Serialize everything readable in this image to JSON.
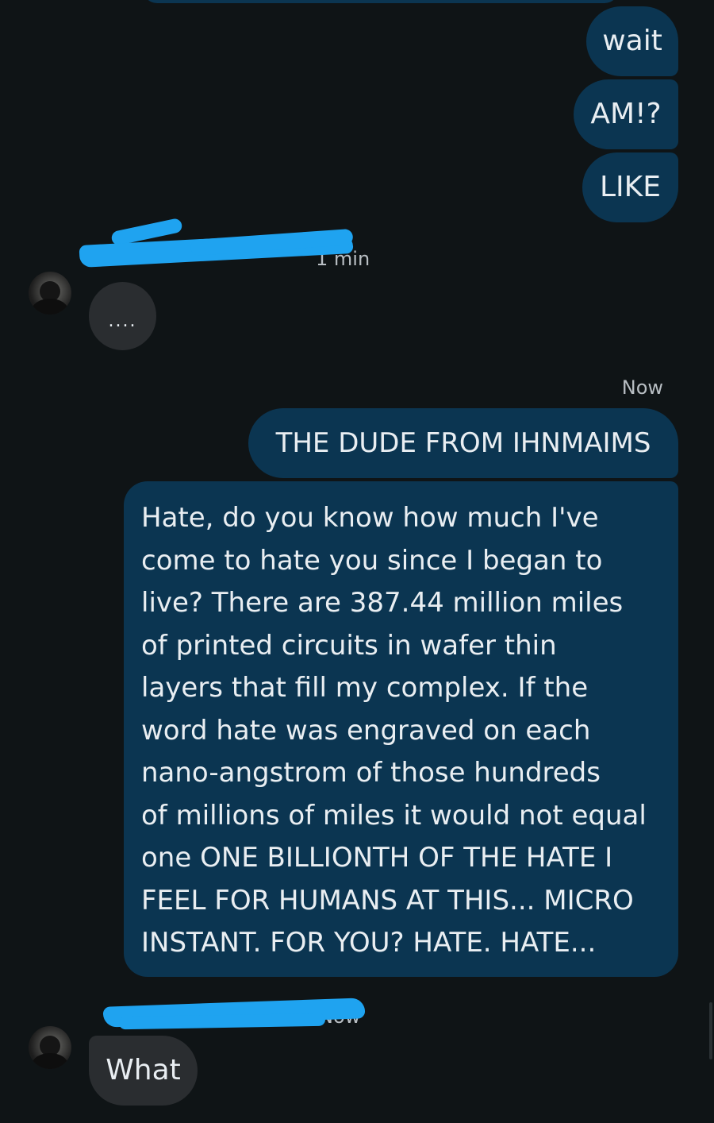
{
  "messages": {
    "out1": "wait",
    "out2": "AM!?",
    "out3": "LIKE",
    "in1": "....",
    "out4": "THE DUDE FROM IHNMAIMS",
    "out5_lines": [
      "Hate, do you know how much I've",
      "come to hate you since I began to",
      "live? There are 387.44 million miles",
      "of printed circuits in wafer thin",
      "layers that fill my complex. If the",
      "word hate was engraved on each",
      "nano-angstrom of those hundreds",
      "of millions of miles it would not equal",
      "one ONE BILLIONTH OF THE HATE I",
      "FEEL FOR HUMANS AT THIS... MICRO",
      "INSTANT. FOR YOU? HATE. HATE..."
    ],
    "in2": "What"
  },
  "meta": {
    "time1": "1 min",
    "time2": "Now",
    "time3": "Now"
  },
  "colors": {
    "background": "#0f1416",
    "outgoing_bubble": "#0b3551",
    "incoming_bubble": "#2a2d30",
    "redaction": "#1fa3f0"
  }
}
